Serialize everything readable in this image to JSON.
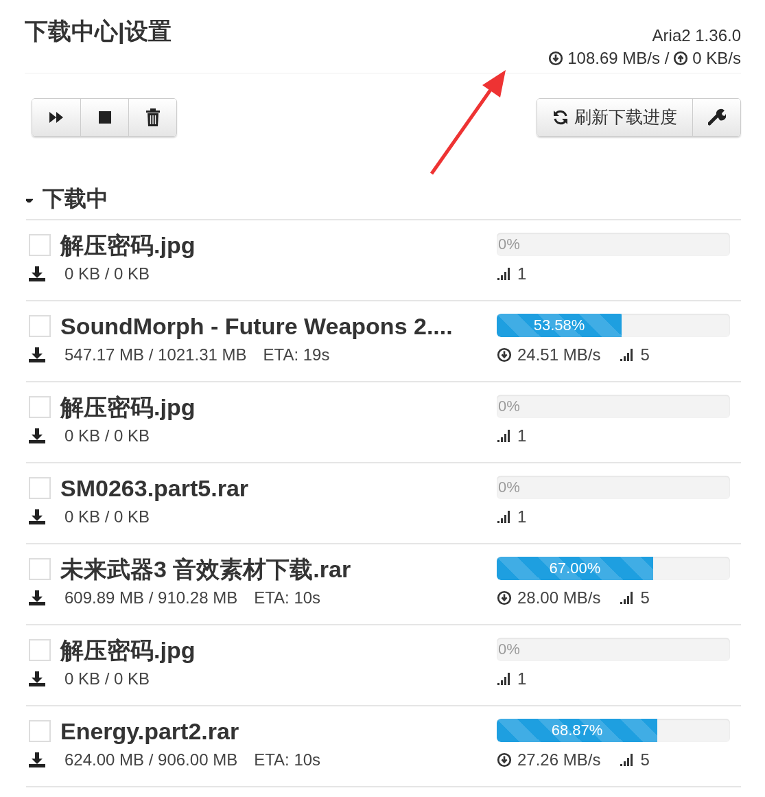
{
  "header": {
    "title": "下载中心|设置",
    "version": "Aria2 1.36.0",
    "download_speed": "108.69 MB/s /",
    "upload_speed": "0 KB/s"
  },
  "toolbar": {
    "left_buttons": [
      {
        "kind": "resume"
      },
      {
        "kind": "stop"
      },
      {
        "kind": "delete"
      }
    ],
    "refresh_button": "刷新下载进度",
    "settings_button": {
      "kind": "wrench"
    }
  },
  "annotation": {
    "kind": "arrow"
  },
  "section": {
    "title": "下载中",
    "expanded": true
  },
  "downloads": [
    {
      "name": "解压密码.jpg",
      "checked": false,
      "size": "0 KB / 0 KB",
      "level": 0,
      "percent": "0%",
      "connections": "1"
    },
    {
      "name": "SoundMorph - Future Weapons 2....",
      "checked": false,
      "size": "547.17 MB / 1021.31 MB",
      "eta": "ETA: 19s",
      "level": 0.5358,
      "percent": "53.58%",
      "speed": "24.51 MB/s",
      "connections": "5"
    },
    {
      "name": "解压密码.jpg",
      "checked": false,
      "size": "0 KB / 0 KB",
      "level": 0,
      "percent": "0%",
      "connections": "1"
    },
    {
      "name": "SM0263.part5.rar",
      "checked": false,
      "size": "0 KB / 0 KB",
      "level": 0,
      "percent": "0%",
      "connections": "1"
    },
    {
      "name": "未来武器3 音效素材下载.rar",
      "checked": false,
      "size": "609.89 MB / 910.28 MB",
      "eta": "ETA: 10s",
      "level": 0.67,
      "percent": "67.00%",
      "speed": "28.00 MB/s",
      "connections": "5"
    },
    {
      "name": "解压密码.jpg",
      "checked": false,
      "size": "0 KB / 0 KB",
      "level": 0,
      "percent": "0%",
      "connections": "1"
    },
    {
      "name": "Energy.part2.rar",
      "checked": false,
      "size": "624.00 MB / 906.00 MB",
      "eta": "ETA: 10s",
      "level": 0.6887,
      "percent": "68.87%",
      "speed": "27.26 MB/s",
      "connections": "5"
    }
  ]
}
